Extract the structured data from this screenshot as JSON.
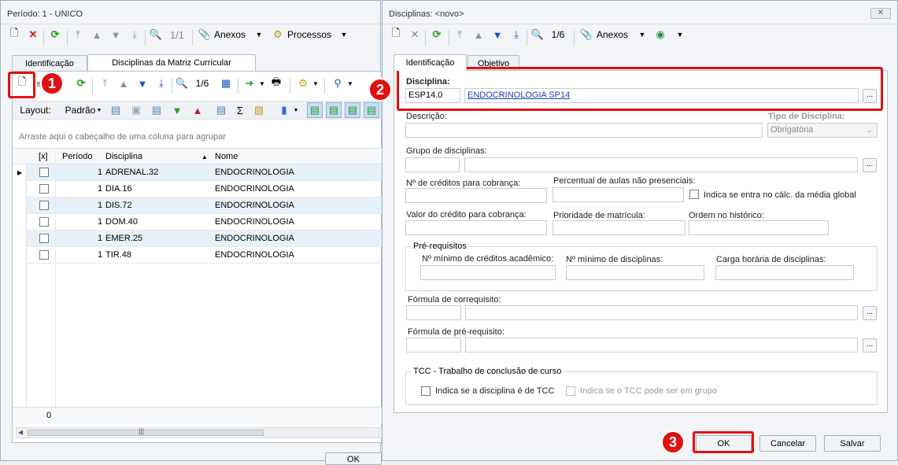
{
  "left_window": {
    "title": "Período: 1 - UNICO",
    "toolbar": {
      "nav_count": "1/1",
      "attachments": "Anexos",
      "processes": "Processos"
    },
    "tabs": [
      "Identificação",
      "Disciplinas da Matriz Curricular"
    ],
    "grid_toolbar": {
      "nav_count": "1/6",
      "layout_label": "Layout:",
      "layout_value": "Padrão"
    },
    "group_hint": "Arraste aqui o cabeçalho de uma coluna para agrupar",
    "columns": [
      "[x]",
      "Período",
      "Disciplina",
      "Nome"
    ],
    "rows": [
      {
        "periodo": "1",
        "disciplina": "ADRENAL.32",
        "nome": "ENDOCRINOLOGIA"
      },
      {
        "periodo": "1",
        "disciplina": "DIA.16",
        "nome": "ENDOCRINOLOGIA"
      },
      {
        "periodo": "1",
        "disciplina": "DIS.72",
        "nome": "ENDOCRINOLOGIA"
      },
      {
        "periodo": "1",
        "disciplina": "DOM.40",
        "nome": "ENDOCRINOLOGIA"
      },
      {
        "periodo": "1",
        "disciplina": "EMER.25",
        "nome": "ENDOCRINOLOGIA"
      },
      {
        "periodo": "1",
        "disciplina": "TIR.48",
        "nome": "ENDOCRINOLOGIA"
      }
    ],
    "footer_count": "0",
    "ok_label": "OK"
  },
  "right_window": {
    "title": "Disciplinas: <novo>",
    "toolbar": {
      "nav_count": "1/6",
      "attachments": "Anexos"
    },
    "tabs": [
      "Identificação",
      "Objetivo"
    ],
    "form": {
      "disciplina_label": "Disciplina:",
      "disciplina_code": "ESP14.0",
      "disciplina_name": "ENDOCRINOLOGIA SP14",
      "descricao_label": "Descrição:",
      "tipo_label": "Tipo de Disciplina:",
      "tipo_value": "Obrigatória",
      "grupo_label": "Grupo de disciplinas:",
      "creditos_cobranca_label": "Nº de créditos para cobrança:",
      "percentual_label": "Percentual de aulas não presenciais:",
      "indica_media_label": "Indica se entra no cálc. da média global",
      "valor_credito_label": "Valor do crédito para cobrança:",
      "prioridade_label": "Prioridade de matrícula:",
      "ordem_label": "Ordem no histórico:",
      "prereq_group": "Pré-requisitos",
      "min_creditos_label": "Nº mínimo de créditos acadêmico:",
      "min_disciplinas_label": "Nº mínimo de disciplinas:",
      "carga_label": "Carga horária de disciplinas:",
      "formula_coreq_label": "Fórmula de correquisito:",
      "formula_prereq_label": "Fórmula de pré-requisito:",
      "tcc_group": "TCC - Trabalho de conclusão de curso",
      "tcc_check_label": "Indica se a disciplina é de TCC",
      "tcc_group_check_label": "Indica se o TCC pode ser em grupo"
    },
    "buttons": {
      "ok": "OK",
      "cancel": "Cancelar",
      "save": "Salvar"
    }
  },
  "callouts": [
    "1",
    "2",
    "3"
  ],
  "colors": {
    "callout_red": "#e11010",
    "link_blue": "#1a3fb0",
    "row_alt": "#e8f0f8"
  }
}
